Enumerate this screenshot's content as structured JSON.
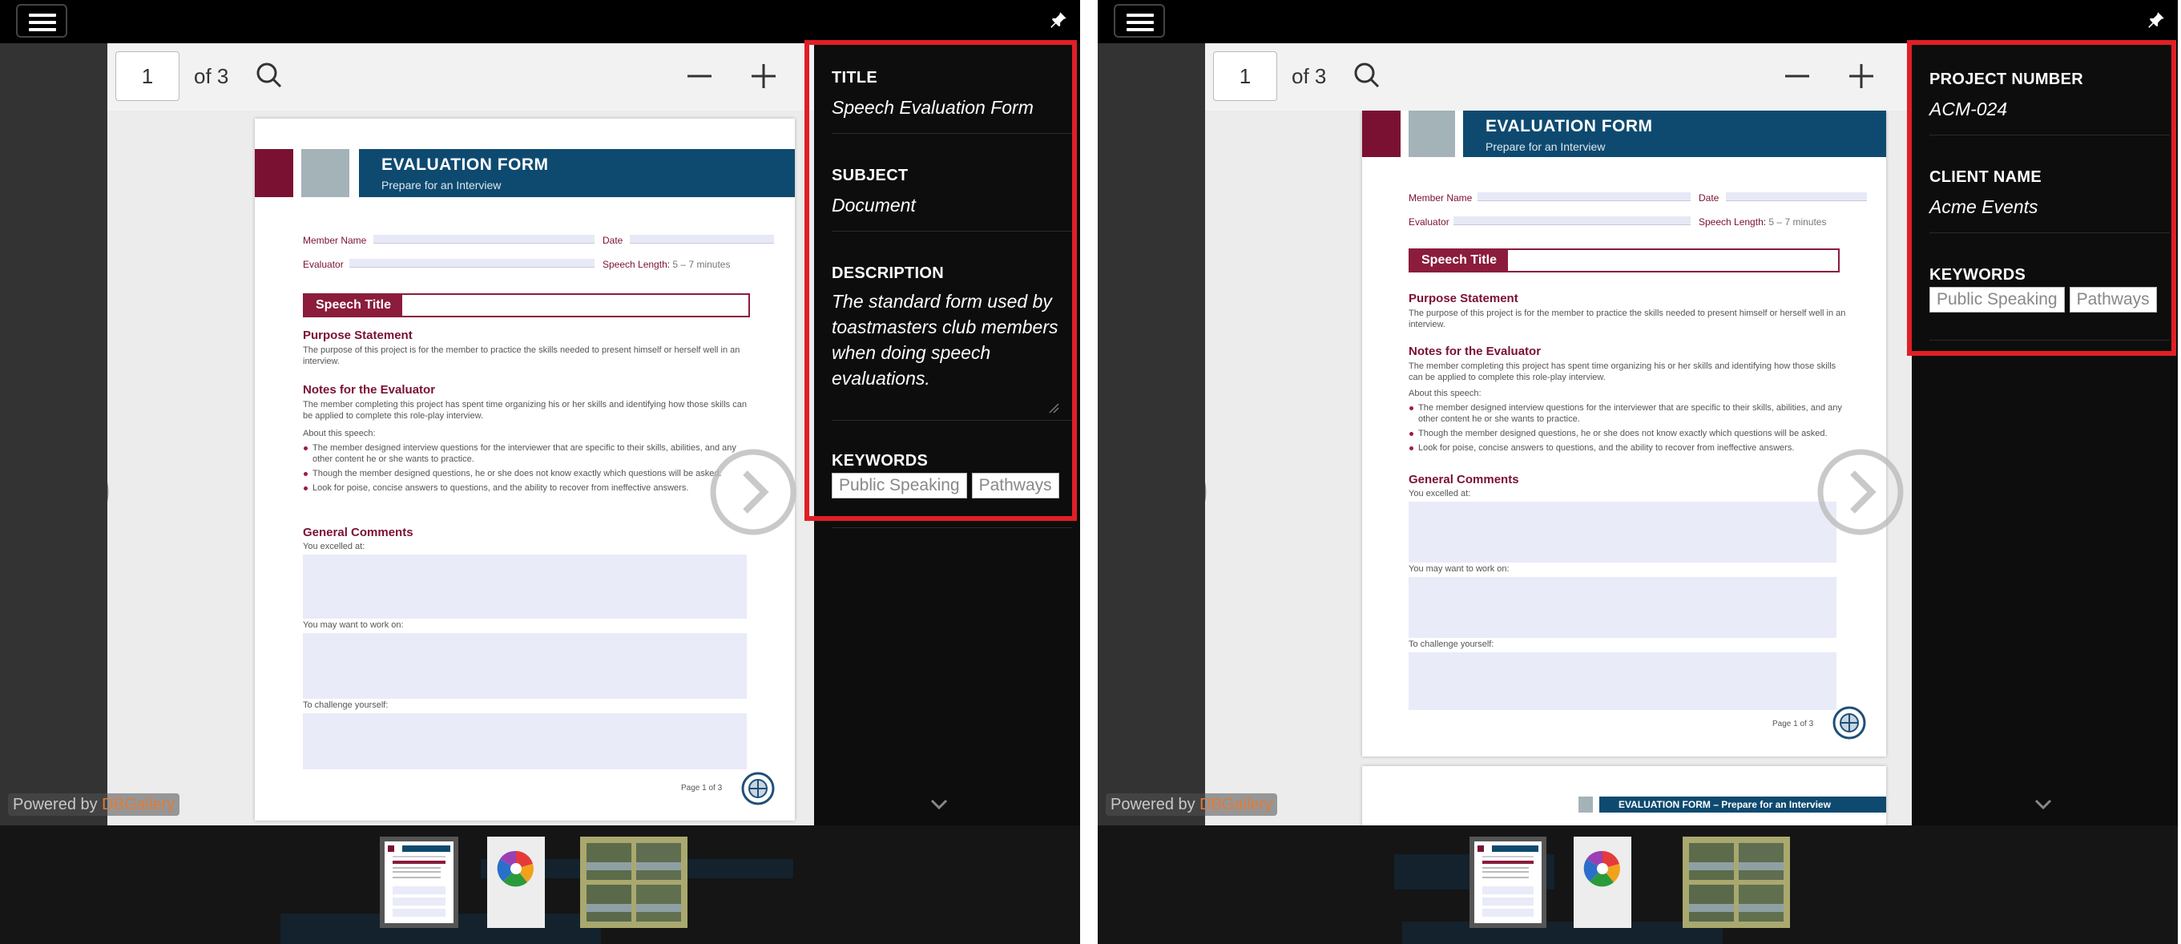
{
  "left": {
    "toolbar": {
      "page_number": "1",
      "page_count_label": "of 3"
    },
    "document": {
      "header_title": "EVALUATION FORM",
      "header_subtitle": "Prepare for an Interview",
      "member_name_label": "Member Name",
      "date_label": "Date",
      "evaluator_label": "Evaluator",
      "speech_length_label": "Speech Length:",
      "speech_length_value": "5 – 7 minutes",
      "speech_title_label": "Speech Title",
      "purpose_heading": "Purpose Statement",
      "purpose_text": "The purpose of this project is for the member to practice the skills needed to present himself or herself well in an interview.",
      "notes_heading": "Notes for the Evaluator",
      "notes_text": "The member completing this project has spent time organizing his or her skills and identifying how those skills can be applied to complete this role-play interview.",
      "about_label": "About this speech:",
      "bullets": [
        "The member designed interview questions for the interviewer that are specific to their skills, abilities, and any other content he or she wants to practice.",
        "Though the member designed questions, he or she does not know exactly which questions will be asked.",
        "Look for poise, concise answers to questions, and the ability to recover from ineffective answers."
      ],
      "general_heading": "General Comments",
      "excelled_label": "You excelled at:",
      "work_on_label": "You may want to work on:",
      "challenge_label": "To challenge yourself:",
      "page_footer": "Page 1 of 3"
    },
    "powered_by_prefix": "Powered by ",
    "powered_by_brand": "DBGallery",
    "properties": {
      "title_label": "TITLE",
      "title_value": "Speech Evaluation Form",
      "subject_label": "SUBJECT",
      "subject_value": "Document",
      "description_label": "DESCRIPTION",
      "description_value": "The standard form used by toastmasters club members when doing speech evaluations.",
      "keywords_label": "KEYWORDS",
      "keywords": [
        "Public Speaking",
        "Pathways"
      ]
    }
  },
  "right": {
    "toolbar": {
      "page_number": "1",
      "page_count_label": "of 3"
    },
    "document": {
      "header_title": "EVALUATION FORM",
      "header_subtitle": "Prepare for an Interview",
      "member_name_label": "Member Name",
      "date_label": "Date",
      "evaluator_label": "Evaluator",
      "speech_length_label": "Speech Length:",
      "speech_length_value": "5 – 7 minutes",
      "speech_title_label": "Speech Title",
      "purpose_heading": "Purpose Statement",
      "purpose_text": "The purpose of this project is for the member to practice the skills needed to present himself or herself well in an interview.",
      "notes_heading": "Notes for the Evaluator",
      "notes_text": "The member completing this project has spent time organizing his or her skills and identifying how those skills can be applied to complete this role-play interview.",
      "about_label": "About this speech:",
      "bullets": [
        "The member designed interview questions for the interviewer that are specific to their skills, abilities, and any other content he or she wants to practice.",
        "Though the member designed questions, he or she does not know exactly which questions will be asked.",
        "Look for poise, concise answers to questions, and the ability to recover from ineffective answers."
      ],
      "general_heading": "General Comments",
      "excelled_label": "You excelled at:",
      "work_on_label": "You may want to work on:",
      "challenge_label": "To challenge yourself:",
      "page_footer": "Page 1 of 3",
      "page2_header": "EVALUATION FORM – Prepare for an Interview"
    },
    "powered_by_prefix": "Powered by ",
    "powered_by_brand": "DBGallery",
    "properties": {
      "project_number_label": "PROJECT NUMBER",
      "project_number_value": "ACM-024",
      "client_name_label": "CLIENT NAME",
      "client_name_value": "Acme Events",
      "keywords_label": "KEYWORDS",
      "keywords": [
        "Public Speaking",
        "Pathways"
      ]
    }
  },
  "colors": {
    "accent_red": "#e01f26",
    "brand_orange": "#e07b39",
    "form_maroon": "#7b1132",
    "form_navy": "#0e4a70"
  },
  "icons": [
    "menu-icon",
    "pin-icon",
    "search-icon",
    "zoom-out-icon",
    "zoom-in-icon",
    "previous-arrow-icon",
    "next-arrow-icon",
    "chevron-down-icon",
    "resize-grip-icon"
  ]
}
